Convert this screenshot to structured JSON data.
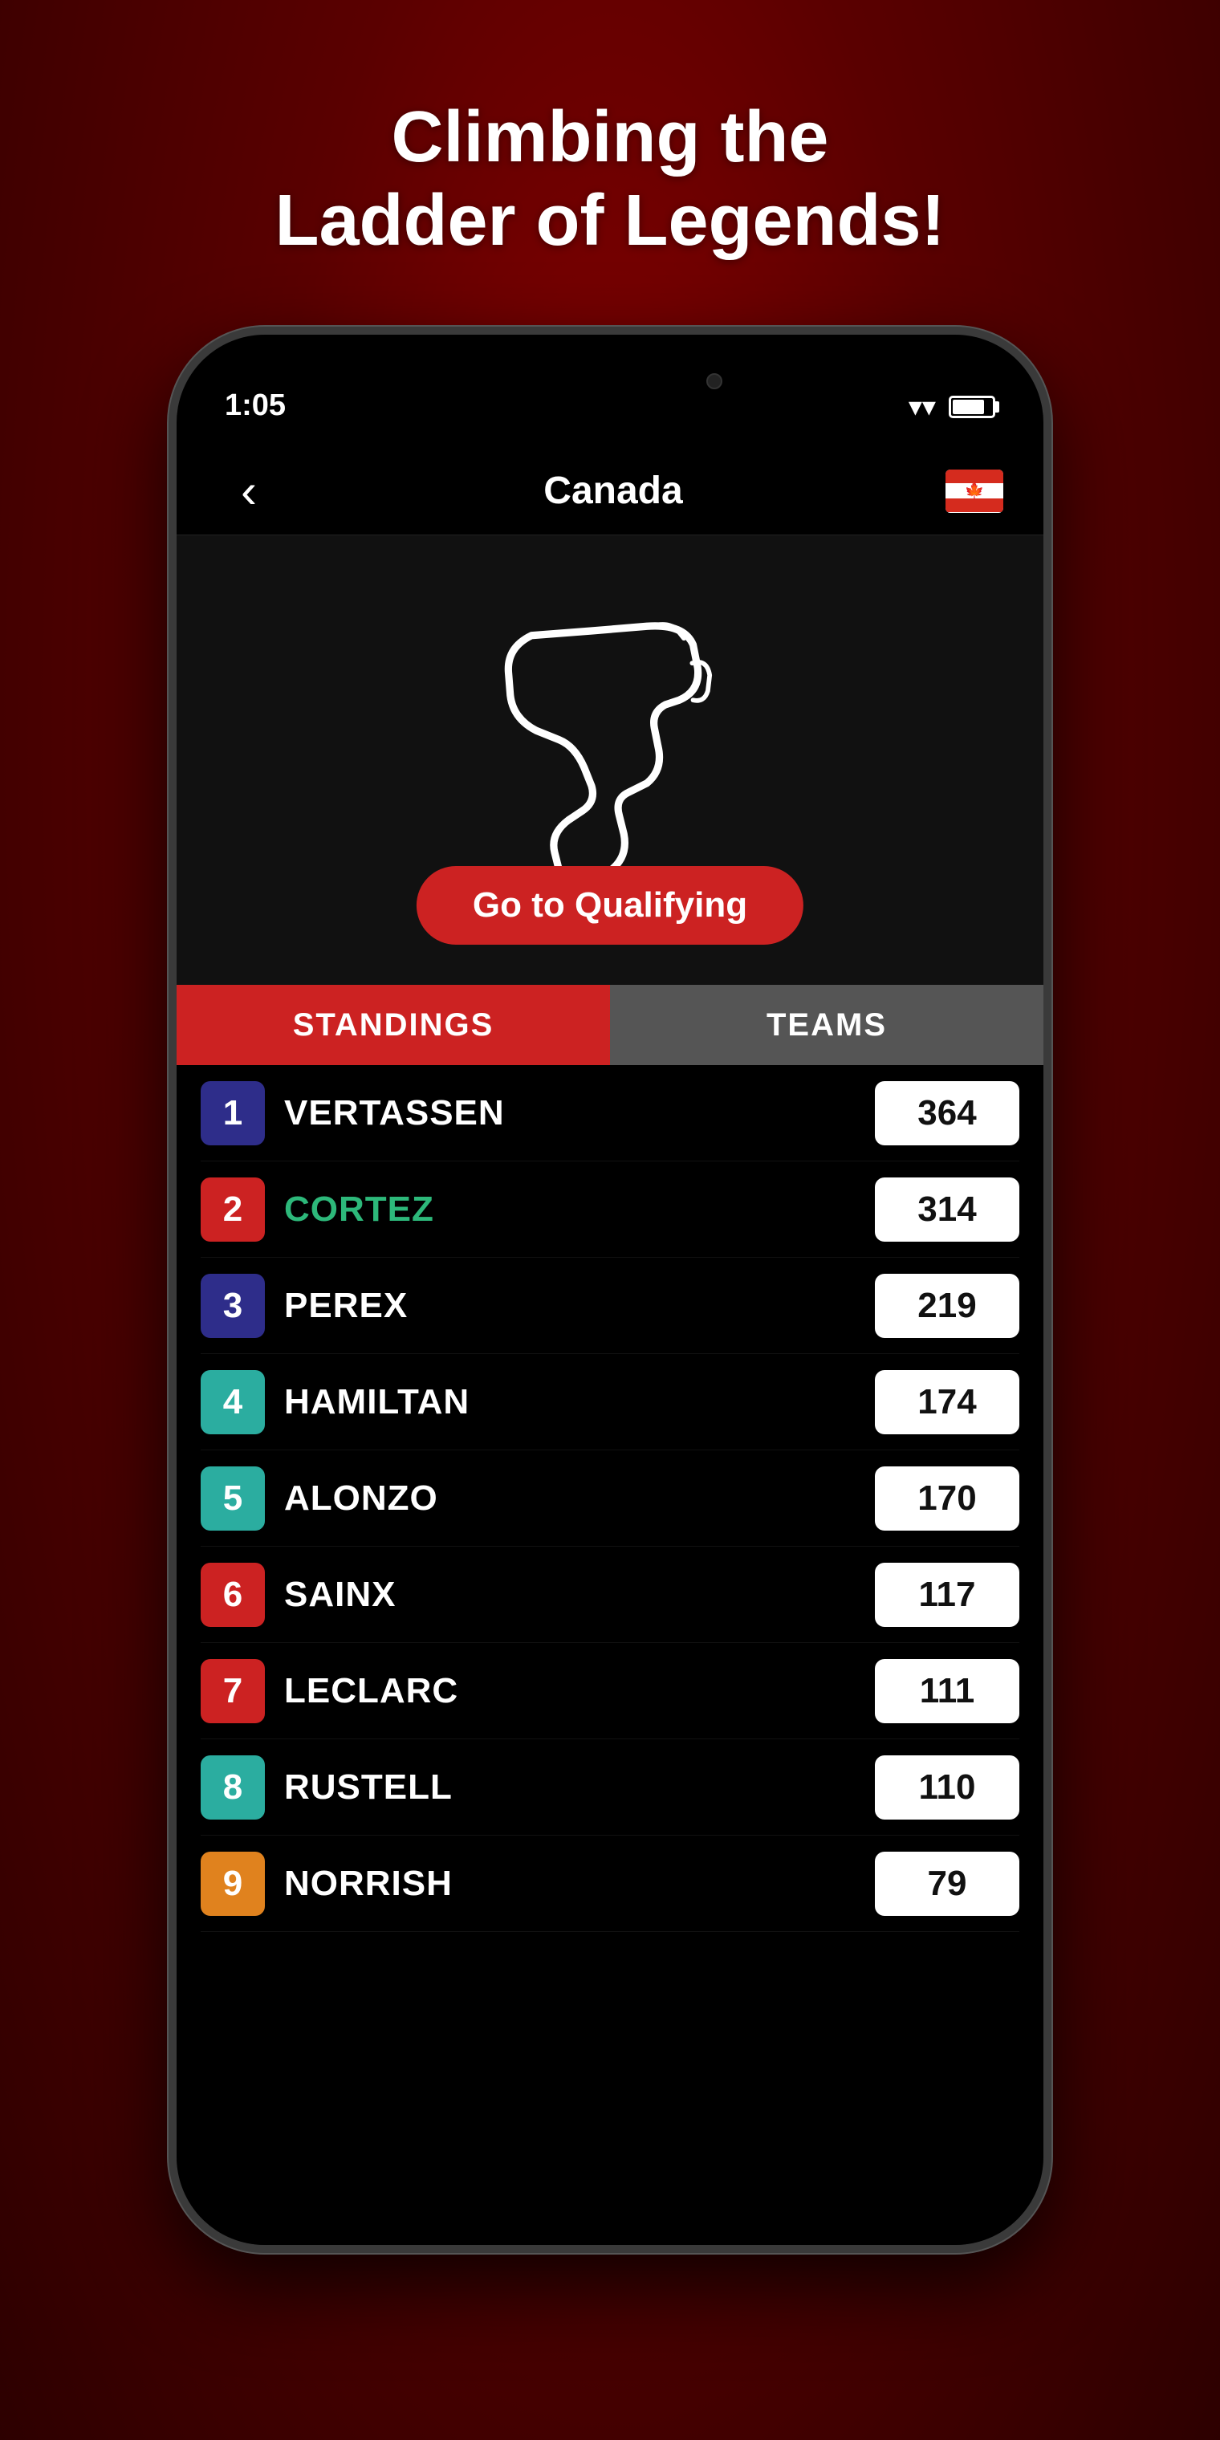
{
  "page": {
    "title_line1": "Climbing the",
    "title_line2": "Ladder of Legends!"
  },
  "phone": {
    "status_time": "1:05",
    "nav_title": "Canada",
    "back_label": "‹",
    "qualifying_button": "Go to Qualifying",
    "tab_standings": "STANDINGS",
    "tab_teams": "TEAMS"
  },
  "standings": [
    {
      "position": "1",
      "name": "VERTASSEN",
      "points": "364",
      "color": "#2e2d8a",
      "highlight": false
    },
    {
      "position": "2",
      "name": "CORTEZ",
      "points": "314",
      "color": "#cc2222",
      "highlight": true
    },
    {
      "position": "3",
      "name": "PEREX",
      "points": "219",
      "color": "#2e2d8a",
      "highlight": false
    },
    {
      "position": "4",
      "name": "HAMILTAN",
      "points": "174",
      "color": "#2bada0",
      "highlight": false
    },
    {
      "position": "5",
      "name": "ALONZO",
      "points": "170",
      "color": "#2bada0",
      "highlight": false
    },
    {
      "position": "6",
      "name": "SAINX",
      "points": "117",
      "color": "#cc2222",
      "highlight": false
    },
    {
      "position": "7",
      "name": "LECLARC",
      "points": "111",
      "color": "#cc2222",
      "highlight": false
    },
    {
      "position": "8",
      "name": "RUSTELL",
      "points": "110",
      "color": "#2bada0",
      "highlight": false
    },
    {
      "position": "9",
      "name": "NORRISH",
      "points": "79",
      "color": "#e0821e",
      "highlight": false
    }
  ]
}
